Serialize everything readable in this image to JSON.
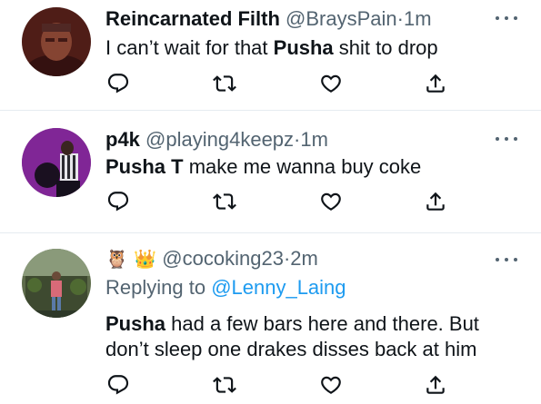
{
  "tweets": [
    {
      "display_name": "Reincarnated Filth",
      "handle": "@BraysPain",
      "separator": "·",
      "time": "1m",
      "text_before": "I can’t wait for that ",
      "text_bold": "Pusha",
      "text_after": " shit to drop",
      "actions": [
        "reply-icon",
        "retweet-icon",
        "like-icon",
        "share-icon"
      ]
    },
    {
      "display_name": "p4k",
      "handle": "@playing4keepz",
      "separator": "·",
      "time": "1m",
      "text_bold": "Pusha T",
      "text_after": " make me wanna buy coke",
      "actions": [
        "reply-icon",
        "retweet-icon",
        "like-icon",
        "share-icon"
      ]
    },
    {
      "display_name_emoji": "🦉 👑",
      "handle": "@cocoking23",
      "separator": "·",
      "time": "2m",
      "replying_prefix": "Replying to ",
      "replying_to": "@Lenny_Laing",
      "line1_bold": "Pusha",
      "line1_rest": " had a few bars here and there. But",
      "line2": "don’t sleep one drakes disses back at him",
      "actions": [
        "reply-icon",
        "retweet-icon",
        "like-icon",
        "share-icon"
      ]
    }
  ],
  "colors": {
    "text": "#0f1419",
    "secondary": "#536471",
    "link": "#1d9bf0",
    "divider": "#e6ecf0"
  }
}
